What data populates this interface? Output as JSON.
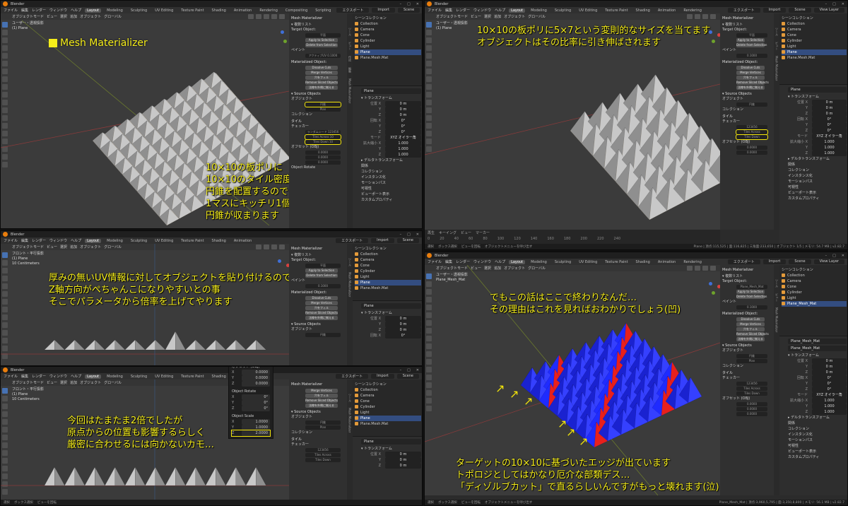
{
  "app": {
    "window_title": "Blender",
    "menus": [
      "ファイル",
      "編集",
      "レンダー",
      "ウィンドウ",
      "ヘルプ"
    ],
    "workspaces": [
      "Layout",
      "Modeling",
      "Sculpting",
      "UV Editing",
      "Texture Paint",
      "Shading",
      "Animation",
      "Rendering",
      "Compositing",
      "Scripting"
    ],
    "scene": "Scene",
    "view_layer": "View Layer",
    "btn_export": "エクスポート",
    "btn_import": "Import"
  },
  "viewport": {
    "mode": "オブジェクトモード",
    "header_items": [
      "ビュー",
      "選択",
      "追加",
      "オブジェクト"
    ],
    "global": "グローバル",
    "info_top_a": "ユーザー・透視投影",
    "info_top_b": "(1) Plane",
    "info_ortho_a": "フロント・平行投影",
    "info_ortho_b": "(1) Plane",
    "info_ortho_c": "10 Centimeters"
  },
  "npanel": {
    "addon": "Mesh Materializer",
    "uvmap_header": "▾ 複数リスト",
    "target": "Target Object:",
    "target_val": "平面",
    "target_val2": "Plane_Mesh_Mat",
    "apply": "Apply to Selection",
    "delete": "Delete from Selection",
    "paint": "ペイント",
    "uv": "アクティブUV",
    "uv_val": "0.1000",
    "materialized": "Materialized Object:",
    "dissolve": "Dissolve Cuts",
    "merge": "Merge Vertices",
    "fill": "穴をフィル",
    "remove": "Remove Sliced Objects",
    "normals": "法線を外側に揃える",
    "source": "▾ Source Objects",
    "obj_label": "オブジェクト",
    "obj1": "円錐",
    "obj2": "Plan",
    "collection": "コレクション",
    "tile": "タイル",
    "checker": "チェッカー",
    "random": "ランダムシード",
    "seed": "123456",
    "tiles_across": "Tiles Across",
    "tiles_down": "Tiles Down",
    "tiles_across_val": "10",
    "tiles_down_val": "10",
    "offset": "オフセット (OBJ)",
    "offset_val": "0.0000",
    "rotate": "Object Rotate",
    "scale": "Object Scale",
    "scale_val": "1.0000",
    "scale_z_val": "2.0000",
    "tabs": [
      "ツール",
      "ビュー",
      "作成",
      "編集",
      "Mesh Materializer"
    ]
  },
  "outliner": {
    "title": "シーンコレクション",
    "rows": [
      "Collection",
      "Camera",
      "Cone",
      "Cylinder",
      "Light",
      "Plane",
      "Plane.Mesh.Mat"
    ],
    "rows_b": [
      "Collection",
      "Camera",
      "Cone",
      "Cylinder",
      "Light",
      "Plane_Mesh_Mat"
    ]
  },
  "props": {
    "object": "Plane",
    "object_b": "Plane_Mesh_Mat",
    "transform": "▾ トランスフォーム",
    "loc": "位置 X",
    "rot": "回転 X",
    "mode": "モード",
    "mode_val": "XYZ オイラー角",
    "scale": "拡大縮小 X",
    "zero": "0 m",
    "zero_deg": "0°",
    "one": "1.000",
    "delta": "▸ デルタトランスフォーム",
    "rel": "関係",
    "coll": "コレクション",
    "inst": "インスタンス化",
    "motion": "モーションパス",
    "vis": "可視性",
    "vpdisp": "ビューポート表示",
    "custom": "カスタムプロパティ",
    "ylab": "Y",
    "zlab": "Z"
  },
  "timeline": {
    "items": [
      "再生",
      "キーイング",
      "ビュー",
      "マーカー"
    ],
    "start": "開始",
    "start_val": "1",
    "end": "終了",
    "end_val": "250",
    "frames": [
      "0",
      "20",
      "40",
      "60",
      "80",
      "100",
      "120",
      "140",
      "160",
      "180",
      "200",
      "220",
      "240"
    ]
  },
  "status": {
    "left": [
      "選択",
      "ボックス選択",
      "ビューを回転",
      "オブジェクトメニューを呼び出す"
    ],
    "ver_a": "Plane | 頂点:115,525 | 面:116,825 | 三角面:233,650 | オブジェクト 1/5 | メモリ: 54.7 MB | v2.82.7",
    "ver_d": "Plane_Mesh_Mat | 頂点:3,960,5,795 | 面:3,350,8,800 | メモリ: 56.1 MB | v2.82.7"
  },
  "captions": {
    "title": "Mesh Materializer",
    "a": [
      "10×10の板ポリに",
      "10×10のタイル密度で",
      "円錐を配置するので",
      "1マスにキッチリ1個の",
      "円錐が収まります"
    ],
    "b": [
      "10×10の板ポリに5×7という変則的なサイズを当てます",
      "オブジェクトはその比率に引き伸ばされます"
    ],
    "c": [
      "厚みの無いUV情報に対してオブジェクトを貼り付けるので",
      "Z軸方向がぺちゃんこになりやすいとの事",
      "そこでパラメータから倍率を上げてやります"
    ],
    "d1": [
      "でもこの話はここで終わりなんだ…",
      "その理由はこれを見ればおわかりでしょう(凹)"
    ],
    "d2": [
      "ターゲットの10×10に基づいたエッジが出ています",
      "トポロジとしてはかなり厄介な部類デス…",
      "「ディゾルブカット」で直るらしいんですがもっと壊れます(泣)"
    ],
    "e": [
      "今回はたまたま2倍でしたが",
      "原点からの位置も影響するらしく",
      "厳密に合わせるには向かないカモ…"
    ]
  },
  "colors": {
    "caption": "#f6ee1a",
    "highlight": "#f4e60a",
    "viewport": "#3b3b3b",
    "cone_light": "#c8c8c8",
    "cone_dark": "#8f8f8f",
    "base": "#d9b67e",
    "blue": "#1f2bff",
    "red": "#e8201c"
  }
}
